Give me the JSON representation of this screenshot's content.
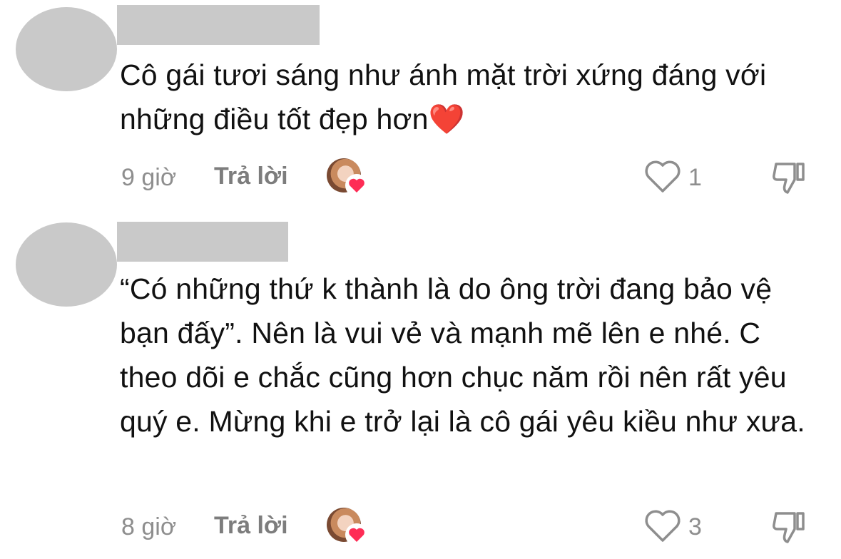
{
  "comments": [
    {
      "text": "Cô gái tươi sáng như ánh mặt trời xứng đáng với những điều tốt đẹp hơn❤️",
      "time": "9 giờ",
      "reply_label": "Trả lời",
      "like_count": "1"
    },
    {
      "text": "“Có những thứ k thành là do ông trời đang bảo vệ bạn đấy”. Nên là vui vẻ và mạnh mẽ lên e nhé. C theo dõi e chắc cũng hơn chục năm rồi nên rất yêu quý e. Mừng khi e trở lại là cô gái yêu kiều như xưa.",
      "time": "8 giờ",
      "reply_label": "Trả lời",
      "like_count": "3"
    }
  ],
  "icons": {
    "like": "heart-outline-icon",
    "dislike": "thumbs-down-icon",
    "creator_liked": "heart-badge-icon"
  },
  "colors": {
    "text": "#111111",
    "meta": "#8e8e8e",
    "placeholder": "#c9c9c9",
    "heart": "#fe2c55"
  }
}
